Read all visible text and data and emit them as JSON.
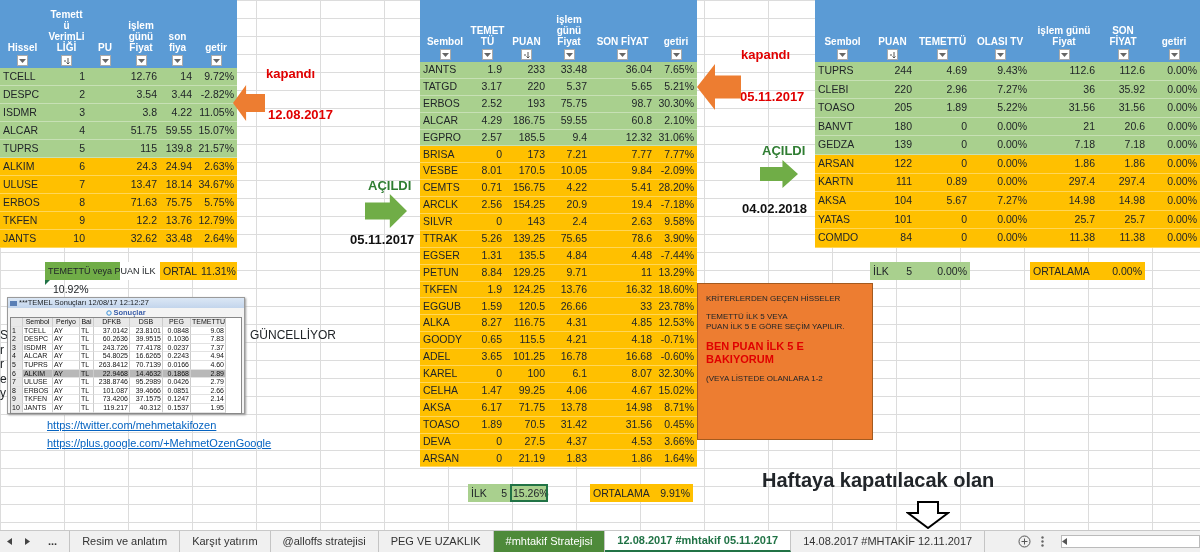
{
  "left_table": {
    "columns": [
      {
        "label": "Hissel",
        "sorted": false
      },
      {
        "label": "Temett\nü\nVerimLi\nLİĞİ",
        "sorted": true
      },
      {
        "label": "PU",
        "sorted": false
      },
      {
        "label": "işlem\ngünü\nFiyat",
        "sorted": false
      },
      {
        "label": "son\nfiya",
        "sorted": false
      },
      {
        "label": "getir",
        "sorted": false
      }
    ],
    "rows": [
      {
        "color": "#a9d08e",
        "cells": [
          "TCELL",
          "1",
          null,
          "12.76",
          "14",
          "9.72%"
        ]
      },
      {
        "color": "#a9d08e",
        "cells": [
          "DESPC",
          "2",
          null,
          "3.54",
          "3.44",
          "-2.82%"
        ]
      },
      {
        "color": "#a9d08e",
        "cells": [
          "ISDMR",
          "3",
          null,
          "3.8",
          "4.22",
          "11.05%"
        ]
      },
      {
        "color": "#a9d08e",
        "cells": [
          "ALCAR",
          "4",
          null,
          "51.75",
          "59.55",
          "15.07%"
        ]
      },
      {
        "color": "#a9d08e",
        "cells": [
          "TUPRS",
          "5",
          null,
          "115",
          "139.8",
          "21.57%"
        ]
      },
      {
        "color": "#ffc000",
        "cells": [
          "ALKIM",
          "6",
          null,
          "24.3",
          "24.94",
          "2.63%"
        ]
      },
      {
        "color": "#ffc000",
        "cells": [
          "ULUSE",
          "7",
          null,
          "13.47",
          "18.14",
          "34.67%"
        ]
      },
      {
        "color": "#ffc000",
        "cells": [
          "ERBOS",
          "8",
          null,
          "71.63",
          "75.75",
          "5.75%"
        ]
      },
      {
        "color": "#ffc000",
        "cells": [
          "TKFEN",
          "9",
          null,
          "12.2",
          "13.76",
          "12.79%"
        ]
      },
      {
        "color": "#ffc000",
        "cells": [
          "JANTS",
          "10",
          null,
          "32.62",
          "33.48",
          "2.64%"
        ]
      }
    ],
    "summary": {
      "label": "TEMETTÜ veya PUAN İLK",
      "average_label": "ORTAL",
      "average": "11.31%",
      "value": "10.92%"
    }
  },
  "middle_table": {
    "columns": [
      {
        "label": "Sembol",
        "sorted": false
      },
      {
        "label": "TEMET\nTÜ",
        "sorted": false
      },
      {
        "label": "PUAN",
        "sorted": true
      },
      {
        "label": "işlem\ngünü\nFiyat",
        "sorted": false
      },
      {
        "label": "SON FİYAT",
        "sorted": false
      },
      {
        "label": "getiri",
        "sorted": false
      }
    ],
    "rows": [
      {
        "color": "#a9d08e",
        "cells": [
          "JANTS",
          "1.9",
          "233",
          "33.48",
          "36.04",
          "7.65%"
        ]
      },
      {
        "color": "#a9d08e",
        "cells": [
          "TATGD",
          "3.17",
          "220",
          "5.37",
          "5.65",
          "5.21%"
        ]
      },
      {
        "color": "#a9d08e",
        "cells": [
          "ERBOS",
          "2.52",
          "193",
          "75.75",
          "98.7",
          "30.30%"
        ]
      },
      {
        "color": "#a9d08e",
        "cells": [
          "ALCAR",
          "4.29",
          "186.75",
          "59.55",
          "60.8",
          "2.10%"
        ]
      },
      {
        "color": "#a9d08e",
        "cells": [
          "EGPRO",
          "2.57",
          "185.5",
          "9.4",
          "12.32",
          "31.06%"
        ]
      },
      {
        "color": "#ffc000",
        "cells": [
          "BRISA",
          "0",
          "173",
          "7.21",
          "7.77",
          "7.77%"
        ]
      },
      {
        "color": "#ffc000",
        "cells": [
          "VESBE",
          "8.01",
          "170.5",
          "10.05",
          "9.84",
          "-2.09%"
        ]
      },
      {
        "color": "#ffc000",
        "cells": [
          "CEMTS",
          "0.71",
          "156.75",
          "4.22",
          "5.41",
          "28.20%"
        ]
      },
      {
        "color": "#ffc000",
        "cells": [
          "ARCLK",
          "2.56",
          "154.25",
          "20.9",
          "19.4",
          "-7.18%"
        ]
      },
      {
        "color": "#ffc000",
        "cells": [
          "SILVR",
          "0",
          "143",
          "2.4",
          "2.63",
          "9.58%"
        ]
      },
      {
        "color": "#ffc000",
        "cells": [
          "TTRAK",
          "5.26",
          "139.25",
          "75.65",
          "78.6",
          "3.90%"
        ]
      },
      {
        "color": "#ffc000",
        "cells": [
          "EGSER",
          "1.31",
          "135.5",
          "4.84",
          "4.48",
          "-7.44%"
        ]
      },
      {
        "color": "#ffc000",
        "cells": [
          "PETUN",
          "8.84",
          "129.25",
          "9.71",
          "11",
          "13.29%"
        ]
      },
      {
        "color": "#ffc000",
        "cells": [
          "TKFEN",
          "1.9",
          "124.25",
          "13.76",
          "16.32",
          "18.60%"
        ]
      },
      {
        "color": "#ffc000",
        "cells": [
          "EGGUB",
          "1.59",
          "120.5",
          "26.66",
          "33",
          "23.78%"
        ]
      },
      {
        "color": "#ffc000",
        "cells": [
          "ALKA",
          "8.27",
          "116.75",
          "4.31",
          "4.85",
          "12.53%"
        ]
      },
      {
        "color": "#ffc000",
        "cells": [
          "GOODY",
          "0.65",
          "115.5",
          "4.21",
          "4.18",
          "-0.71%"
        ]
      },
      {
        "color": "#ffc000",
        "cells": [
          "ADEL",
          "3.65",
          "101.25",
          "16.78",
          "16.68",
          "-0.60%"
        ]
      },
      {
        "color": "#ffc000",
        "cells": [
          "KAREL",
          "0",
          "100",
          "6.1",
          "8.07",
          "32.30%"
        ]
      },
      {
        "color": "#ffc000",
        "cells": [
          "CELHA",
          "1.47",
          "99.25",
          "4.06",
          "4.67",
          "15.02%"
        ]
      },
      {
        "color": "#ffc000",
        "cells": [
          "AKSA",
          "6.17",
          "71.75",
          "13.78",
          "14.98",
          "8.71%"
        ]
      },
      {
        "color": "#ffc000",
        "cells": [
          "TOASO",
          "1.89",
          "70.5",
          "31.42",
          "31.56",
          "0.45%"
        ]
      },
      {
        "color": "#ffc000",
        "cells": [
          "DEVA",
          "0",
          "27.5",
          "4.37",
          "4.53",
          "3.66%"
        ]
      },
      {
        "color": "#ffc000",
        "cells": [
          "ARSAN",
          "0",
          "21.19",
          "1.83",
          "1.86",
          "1.64%"
        ]
      }
    ],
    "summary": {
      "label": "İLK",
      "count": "5",
      "value": "15.26%",
      "value_selected": true,
      "average_label": "ORTALAMA",
      "average": "9.91%"
    }
  },
  "right_table": {
    "columns": [
      {
        "label": "Sembol",
        "sorted": false
      },
      {
        "label": "PUAN",
        "sorted": true
      },
      {
        "label": "TEMETTÜ",
        "sorted": false
      },
      {
        "label": "OLASI TV",
        "sorted": false
      },
      {
        "label": "işlem günü\nFiyat",
        "sorted": false
      },
      {
        "label": "SON\nFİYAT",
        "sorted": false
      },
      {
        "label": "getiri",
        "sorted": false
      }
    ],
    "rows": [
      {
        "color": "#a9d08e",
        "cells": [
          "TUPRS",
          "244",
          "4.69",
          "9.43%",
          "112.6",
          "112.6",
          "0.00%"
        ]
      },
      {
        "color": "#a9d08e",
        "cells": [
          "CLEBI",
          "220",
          "2.96",
          "7.27%",
          "36",
          "35.92",
          "0.00%"
        ]
      },
      {
        "color": "#a9d08e",
        "cells": [
          "TOASO",
          "205",
          "1.89",
          "5.22%",
          "31.56",
          "31.56",
          "0.00%"
        ]
      },
      {
        "color": "#a9d08e",
        "cells": [
          "BANVT",
          "180",
          "0",
          "0.00%",
          "21",
          "20.6",
          "0.00%"
        ]
      },
      {
        "color": "#a9d08e",
        "cells": [
          "GEDZA",
          "139",
          "0",
          "0.00%",
          "7.18",
          "7.18",
          "0.00%"
        ]
      },
      {
        "color": "#ffc000",
        "cells": [
          "ARSAN",
          "122",
          "0",
          "0.00%",
          "1.86",
          "1.86",
          "0.00%"
        ]
      },
      {
        "color": "#ffc000",
        "cells": [
          "KARTN",
          "111",
          "0.89",
          "0.00%",
          "297.4",
          "297.4",
          "0.00%"
        ]
      },
      {
        "color": "#ffc000",
        "cells": [
          "AKSA",
          "104",
          "5.67",
          "7.27%",
          "14.98",
          "14.98",
          "0.00%"
        ]
      },
      {
        "color": "#ffc000",
        "cells": [
          "YATAS",
          "101",
          "0",
          "0.00%",
          "25.7",
          "25.7",
          "0.00%"
        ]
      },
      {
        "color": "#ffc000",
        "cells": [
          "COMDO",
          "84",
          "0",
          "0.00%",
          "11.38",
          "11.38",
          "0.00%"
        ]
      }
    ],
    "summary": {
      "label": "İLK",
      "count": "5",
      "value": "0.00%",
      "value_selected": false,
      "average_label": "ORTALAMA",
      "average": "0.00%"
    }
  },
  "markers": [
    {
      "kind": "closed",
      "status": "kapandı",
      "date": "12.08.2017"
    },
    {
      "kind": "opened",
      "status": "AÇILDI",
      "date": "05.11.2017"
    },
    {
      "kind": "closed",
      "status": "kapandı",
      "date": "05.11.2017"
    },
    {
      "kind": "opened",
      "status": "AÇILDI",
      "date": "04.02.2018"
    }
  ],
  "cut_texts": [
    "S",
    "r",
    "r",
    "e",
    "y"
  ],
  "side_text": "GÜNCELLİYOR",
  "inset_window": {
    "title": "***TEMEL Sonuçları  12/08/17 12:12:27",
    "heading": "Sonuçlar",
    "columns": [
      "",
      "Sembol",
      "Periyo",
      "Bai",
      "DFKB",
      "DSB",
      "PEG",
      "TEMETTU"
    ],
    "rows": [
      {
        "selected": false,
        "cells": [
          "1",
          "TCELL",
          "AY",
          "TL",
          "37.0142",
          "23.8101",
          "0.0848",
          "9.08"
        ]
      },
      {
        "selected": false,
        "cells": [
          "2",
          "DESPC",
          "AY",
          "TL",
          "60.2636",
          "39.9515",
          "0.1036",
          "7.83"
        ]
      },
      {
        "selected": false,
        "cells": [
          "3",
          "ISDMR",
          "AY",
          "TL",
          "243.726",
          "77.4178",
          "0.0237",
          "7.37"
        ]
      },
      {
        "selected": false,
        "cells": [
          "4",
          "ALCAR",
          "AY",
          "TL",
          "54.8025",
          "16.6265",
          "0.2243",
          "4.94"
        ]
      },
      {
        "selected": false,
        "cells": [
          "5",
          "TUPRS",
          "AY",
          "TL",
          "263.8412",
          "70.7139",
          "0.0166",
          "4.60"
        ]
      },
      {
        "selected": true,
        "cells": [
          "6",
          "ALKIM",
          "AY",
          "TL",
          "22.9468",
          "14.4632",
          "0.1868",
          "2.89"
        ]
      },
      {
        "selected": false,
        "cells": [
          "7",
          "ULUSE",
          "AY",
          "TL",
          "238.8746",
          "95.2989",
          "0.0426",
          "2.79"
        ]
      },
      {
        "selected": false,
        "cells": [
          "8",
          "ERBOS",
          "AY",
          "TL",
          "101.087",
          "39.4666",
          "0.0851",
          "2.66"
        ]
      },
      {
        "selected": false,
        "cells": [
          "9",
          "TKFEN",
          "AY",
          "TL",
          "73.4206",
          "37.1575",
          "0.1247",
          "2.14"
        ]
      },
      {
        "selected": false,
        "cells": [
          "10",
          "JANTS",
          "AY",
          "TL",
          "119.217",
          "40.312",
          "0.1537",
          "1.95"
        ]
      }
    ]
  },
  "links": [
    "https://twitter.com/mehmetakifozen",
    "https://plus.google.com/+MehmetOzenGoogle"
  ],
  "note": {
    "lines": [
      {
        "kind": "plain",
        "text": "KRİTERLERDEN GEÇEN HİSSELER"
      },
      {
        "kind": "plain",
        "text": "TEMETTÜ İLK 5 VEYA\n PUAN İLK 5 E GÖRE SEÇİM YAPILIR."
      },
      {
        "kind": "emphasis",
        "text": "BEN PUAN İLK 5 E BAKIYORUM"
      },
      {
        "kind": "plain",
        "text": "(VEYA LİSTEDE OLANLARA 1-2"
      }
    ]
  },
  "callout": "Haftaya kapatılacak olan",
  "sheet_tabs": {
    "more": "...",
    "tabs": [
      {
        "label": "Resim ve anlatım",
        "selected": false
      },
      {
        "label": "Karşıt yatırım",
        "selected": false
      },
      {
        "label": "@alloffs stratejisi",
        "selected": false
      },
      {
        "label": "PEG VE UZAKLIK",
        "selected": false
      },
      {
        "label": "#mhtakif Stratejisi",
        "selected": false,
        "color": "#4e8a3a"
      },
      {
        "label": "12.08.2017 #mhtakif 05.11.2017",
        "selected": true
      },
      {
        "label": "14.08.2017 #MHTAKİF 12.11.2017",
        "selected": false
      }
    ]
  }
}
